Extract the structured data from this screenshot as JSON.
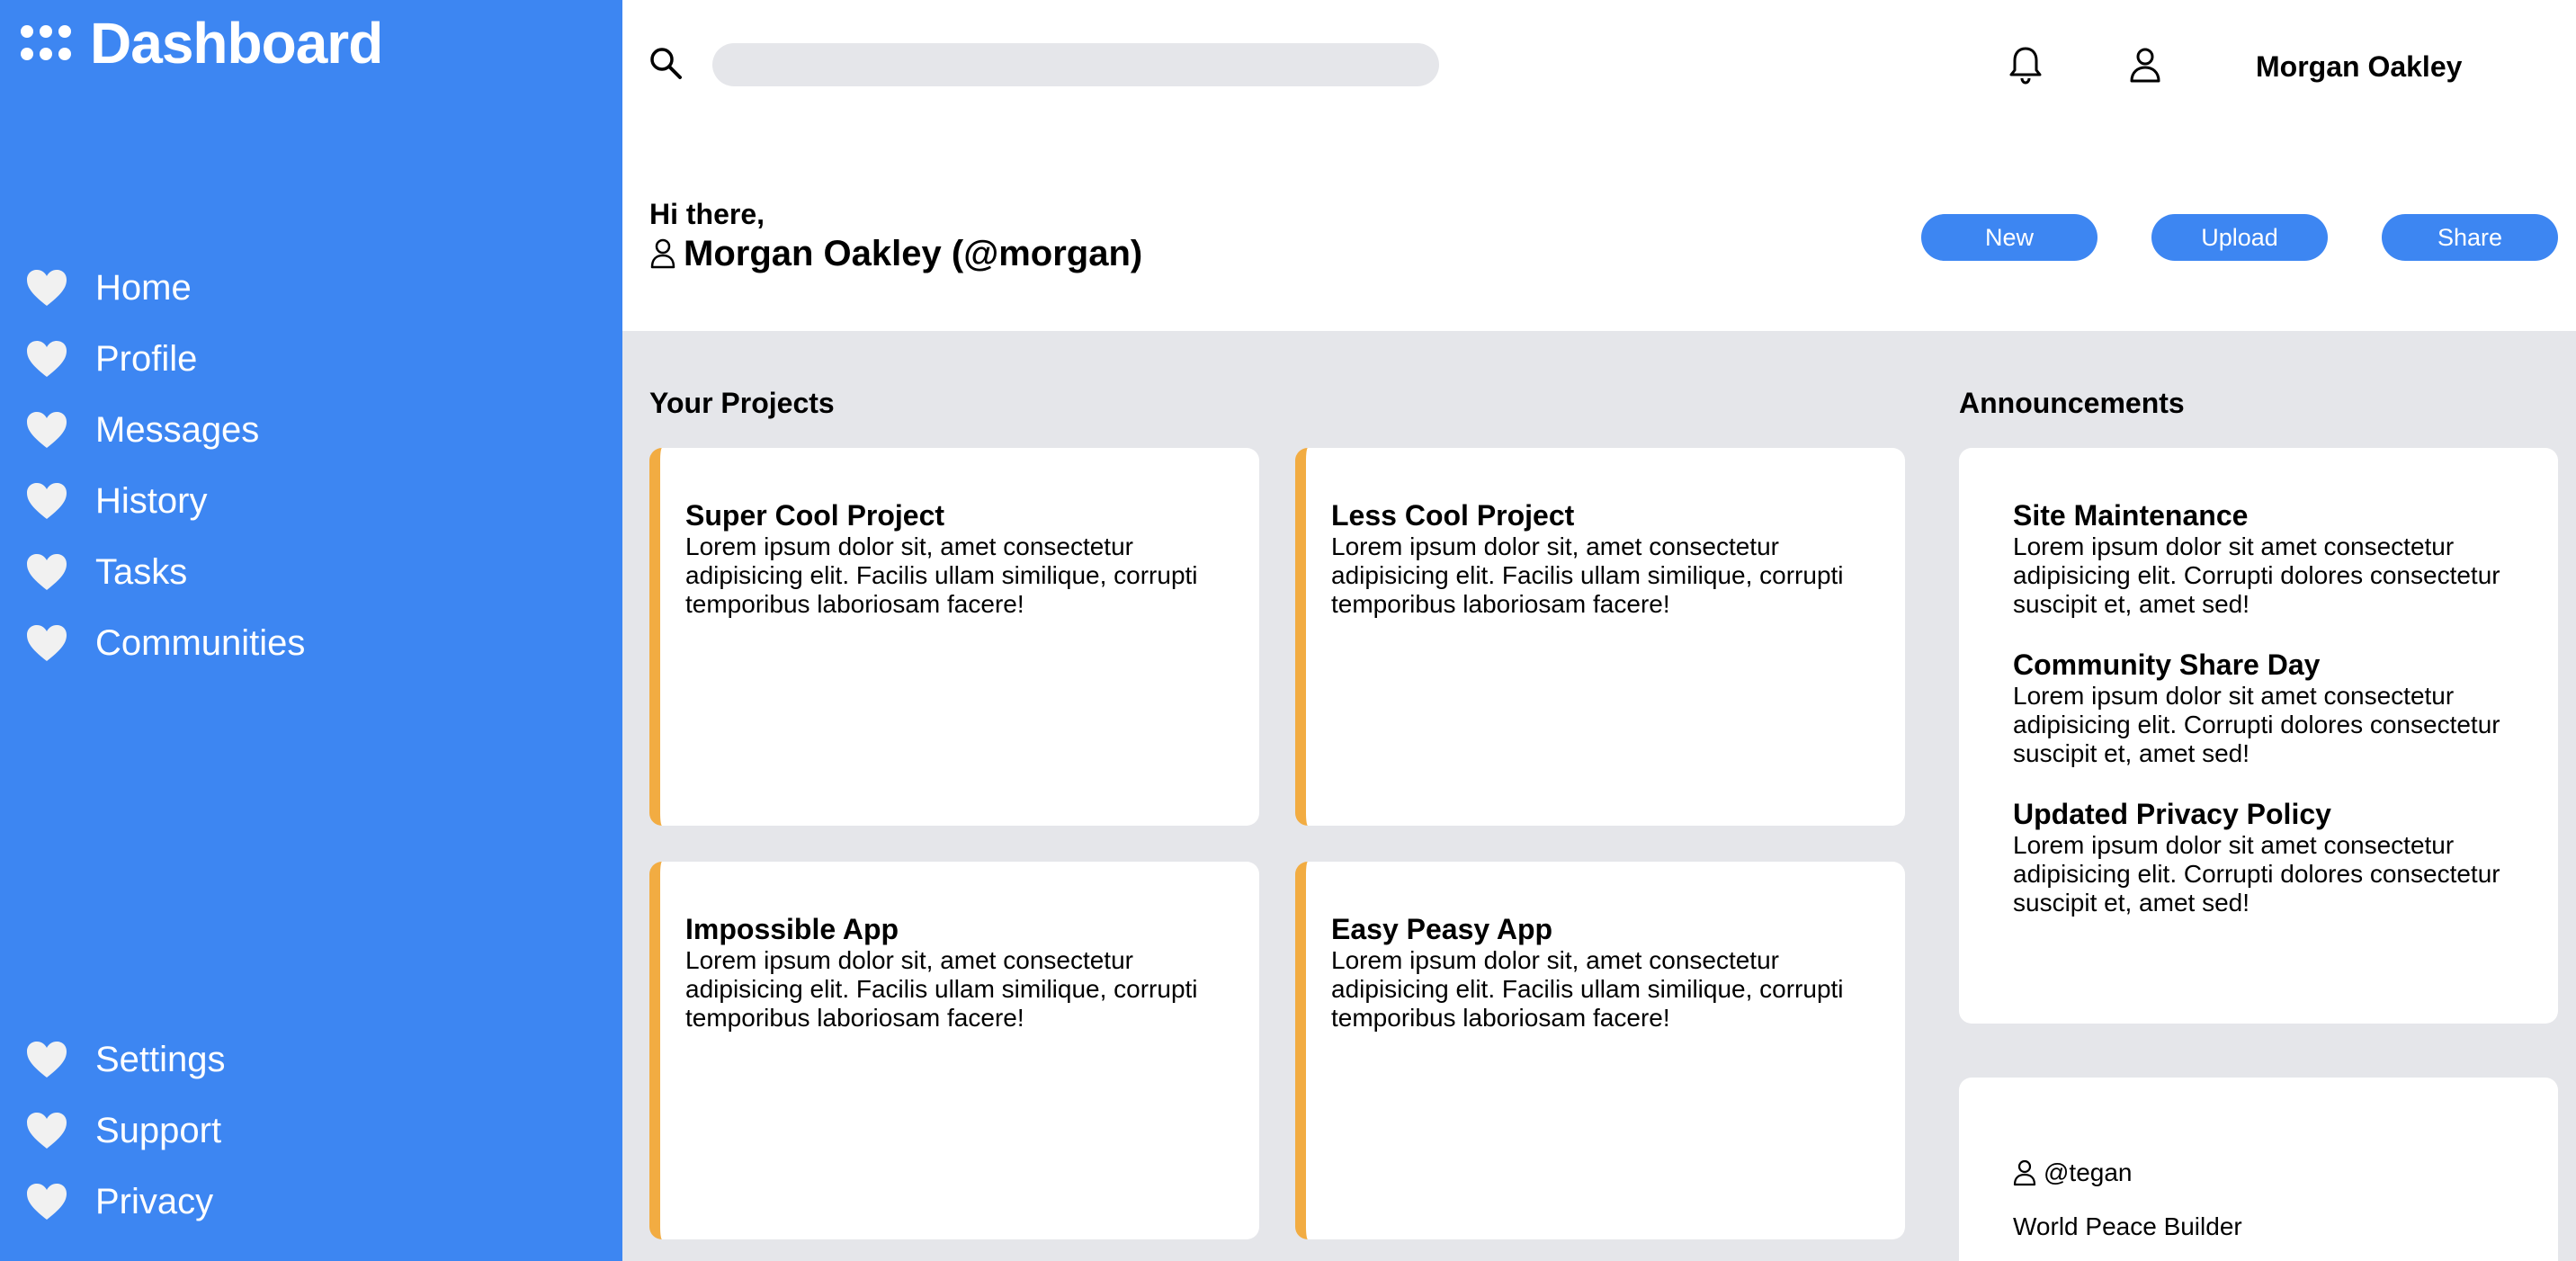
{
  "sidebar": {
    "title": "Dashboard",
    "nav_items": [
      {
        "label": "Home",
        "icon": "heart-icon"
      },
      {
        "label": "Profile",
        "icon": "heart-icon"
      },
      {
        "label": "Messages",
        "icon": "heart-icon"
      },
      {
        "label": "History",
        "icon": "heart-icon"
      },
      {
        "label": "Tasks",
        "icon": "heart-icon"
      },
      {
        "label": "Communities",
        "icon": "heart-icon"
      }
    ],
    "bottom_items": [
      {
        "label": "Settings",
        "icon": "heart-icon"
      },
      {
        "label": "Support",
        "icon": "heart-icon"
      },
      {
        "label": "Privacy",
        "icon": "heart-icon"
      }
    ]
  },
  "header": {
    "search_placeholder": "",
    "username": "Morgan Oakley",
    "greeting": "Hi there,",
    "user_line": "Morgan Oakley (@morgan)",
    "buttons": {
      "new": "New",
      "upload": "Upload",
      "share": "Share"
    }
  },
  "projects": {
    "title": "Your Projects",
    "items": [
      {
        "title": "Super Cool Project",
        "text": "Lorem ipsum dolor sit, amet consectetur adipisicing elit. Facilis ullam similique, corrupti temporibus laboriosam facere!"
      },
      {
        "title": "Less Cool Project",
        "text": "Lorem ipsum dolor sit, amet consectetur adipisicing elit. Facilis ullam similique, corrupti temporibus laboriosam facere!"
      },
      {
        "title": "Impossible App",
        "text": "Lorem ipsum dolor sit, amet consectetur adipisicing elit. Facilis ullam similique, corrupti temporibus laboriosam facere!"
      },
      {
        "title": "Easy Peasy App",
        "text": "Lorem ipsum dolor sit, amet consectetur adipisicing elit. Facilis ullam similique, corrupti temporibus laboriosam facere!"
      }
    ]
  },
  "announcements": {
    "title": "Announcements",
    "items": [
      {
        "title": "Site Maintenance",
        "text": "Lorem ipsum dolor sit amet consectetur adipisicing elit. Corrupti dolores consectetur suscipit et, amet sed!"
      },
      {
        "title": "Community Share Day",
        "text": "Lorem ipsum dolor sit amet consectetur adipisicing elit. Corrupti dolores consectetur suscipit et, amet sed!"
      },
      {
        "title": "Updated Privacy Policy",
        "text": "Lorem ipsum dolor sit amet consectetur adipisicing elit. Corrupti dolores consectetur suscipit et, amet sed!"
      }
    ]
  },
  "user_card": {
    "handle": "@tegan",
    "role": "World Peace Builder"
  },
  "colors": {
    "primary": "#3d86f2",
    "accent": "#f2ac42",
    "background": "#e5e6ea"
  }
}
